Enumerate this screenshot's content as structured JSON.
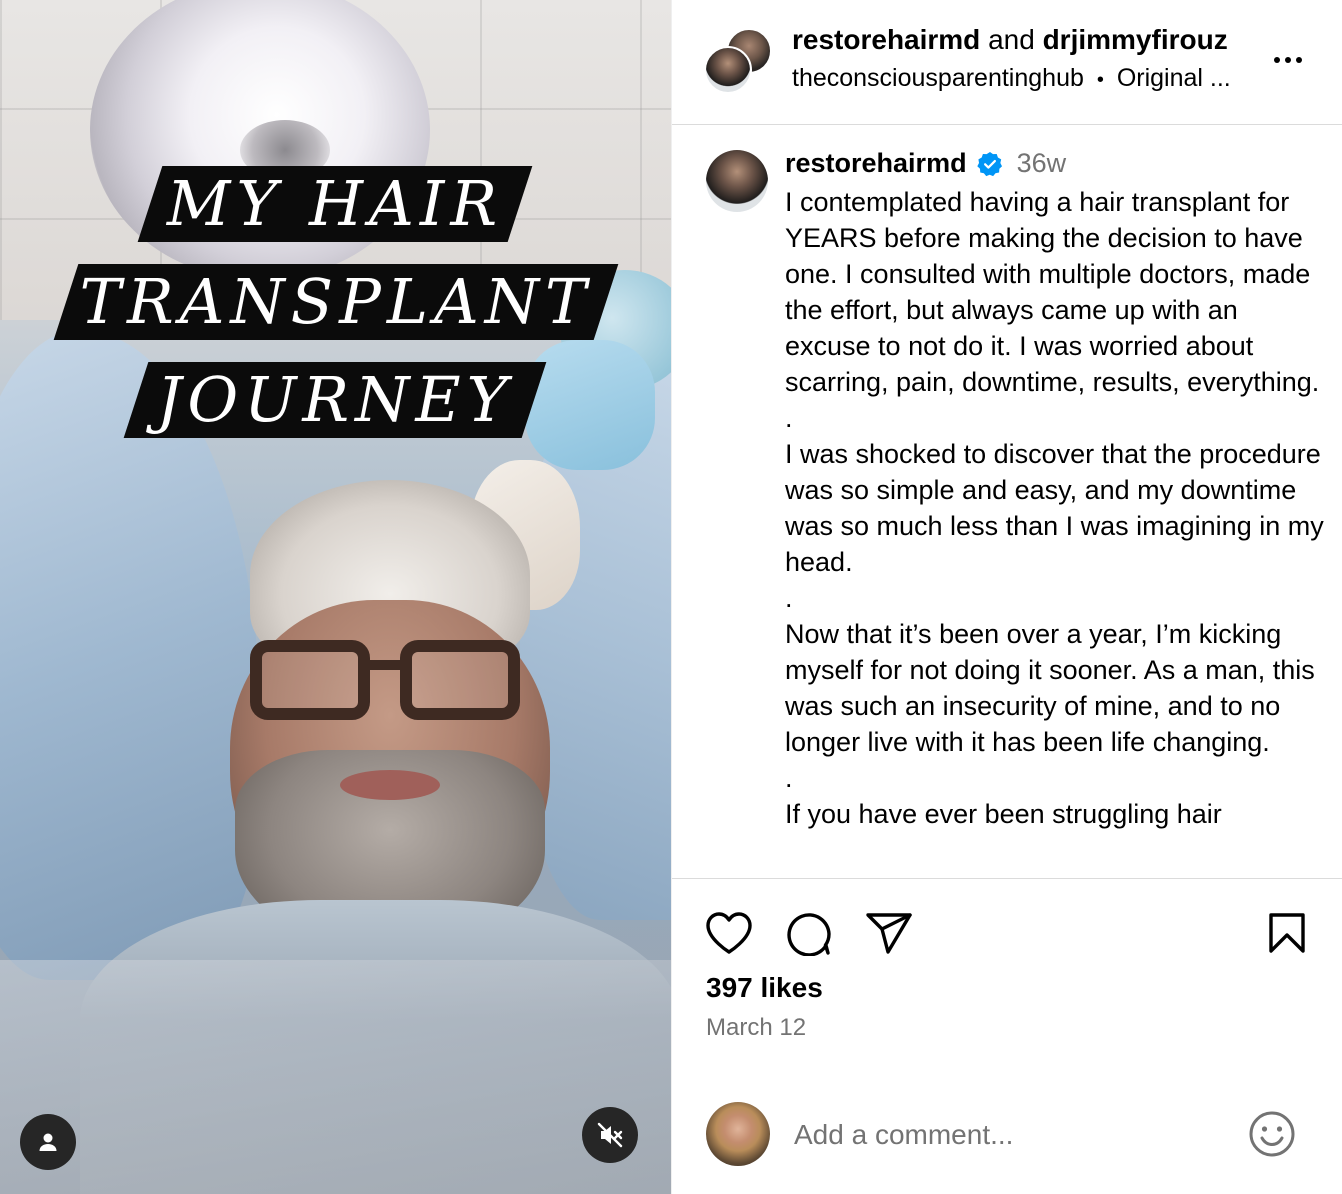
{
  "media": {
    "overlay_lines": [
      "MY HAIR",
      "TRANSPLANT",
      "JOURNEY"
    ],
    "user_tag_icon": "user-icon",
    "mute_icon": "speaker-muted-icon"
  },
  "header": {
    "user1": "restorehairmd",
    "and_text": "and",
    "user2": "drjimmyfirouz",
    "audio_source": "theconsciousparentinghub",
    "separator": "•",
    "audio_label": "Original ...",
    "more_icon": "more-horizontal-icon"
  },
  "caption": {
    "username": "restorehairmd",
    "verified_icon": "verified-badge-icon",
    "time": "36w",
    "text": "I contemplated having a hair transplant for YEARS before making the decision to have one. I consulted with multiple doctors, made the effort, but always came up with an excuse to not do it. I was worried about scarring, pain, downtime, results, everything.\n.\nI was shocked to discover that the procedure was so simple and easy, and my downtime was so much less than I was imagining in my head.\n.\nNow that it’s been over a year, I’m kicking myself for not doing it sooner. As a man, this was such an insecurity of mine, and to no longer live with it has been life changing.\n.\nIf you have ever been struggling hair"
  },
  "actions": {
    "like_icon": "heart-icon",
    "comment_icon": "comment-bubble-icon",
    "share_icon": "paper-plane-icon",
    "save_icon": "bookmark-icon"
  },
  "likes": "397 likes",
  "date": "March 12",
  "comment": {
    "placeholder": "Add a comment...",
    "emoji_icon": "smiley-icon"
  },
  "colors": {
    "verified": "#0095f6",
    "secondary_text": "#737373",
    "divider": "#dbdbdb",
    "overlay_bar": "#0b0b0b"
  }
}
